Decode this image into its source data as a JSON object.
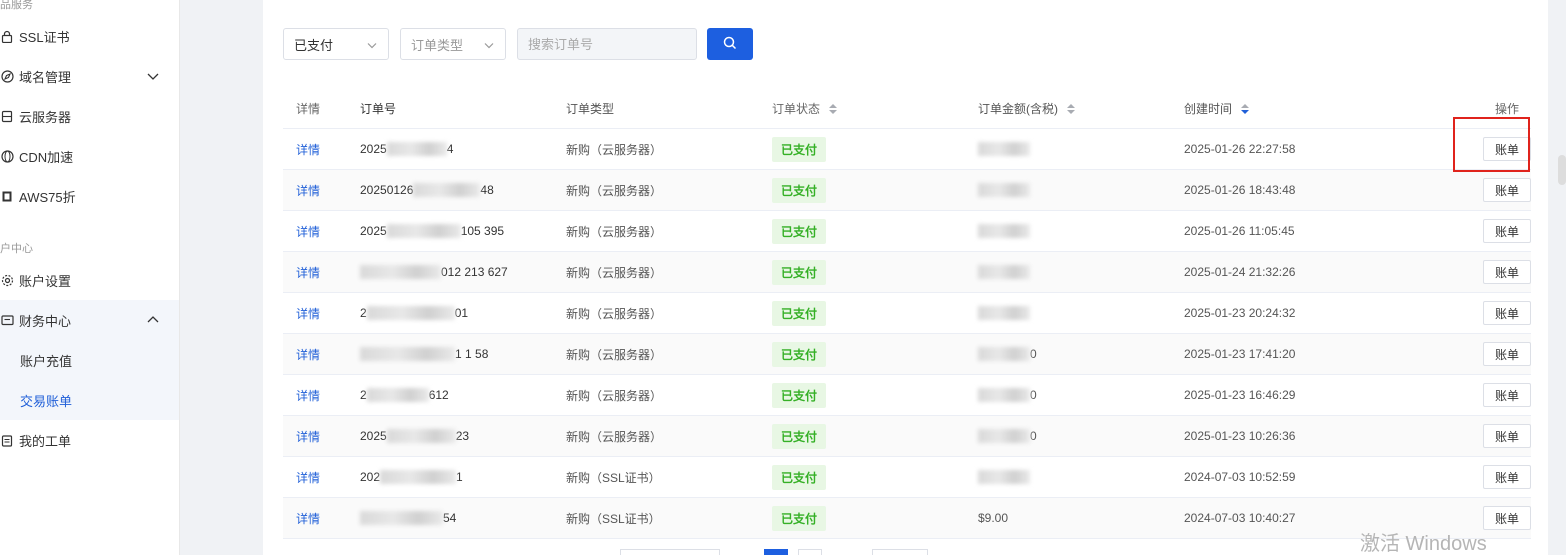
{
  "sidebar": {
    "top_group_label": "品服务",
    "items": [
      {
        "label": "SSL证书",
        "icon": "lock-icon"
      },
      {
        "label": "域名管理",
        "icon": "compass-icon"
      },
      {
        "label": "云服务器",
        "icon": "server-icon"
      },
      {
        "label": "CDN加速",
        "icon": "globe-icon"
      },
      {
        "label": "AWS75折",
        "icon": "aws-icon"
      }
    ],
    "account_group_label": "户中心",
    "account_items": [
      {
        "label": "账户设置",
        "icon": "gear-icon"
      },
      {
        "label": "财务中心",
        "icon": "wallet-icon"
      }
    ],
    "finance_sub": [
      {
        "label": "账户充值"
      },
      {
        "label": "交易账单"
      }
    ],
    "ticket_item": {
      "label": "我的工单",
      "icon": "ticket-icon"
    }
  },
  "filters": {
    "status_value": "已支付",
    "type_placeholder": "订单类型",
    "search_placeholder": "搜索订单号"
  },
  "table": {
    "headers": {
      "detail": "详情",
      "order_no": "订单号",
      "type": "订单类型",
      "status": "订单状态",
      "amount": "订单金额(含税)",
      "created": "创建时间",
      "action": "操作"
    },
    "rows": [
      {
        "detail": "详情",
        "order_no_start": "2025",
        "order_no_end": "4",
        "type": "新购（云服务器）",
        "status": "已支付",
        "amount": "",
        "created": "2025-01-26 22:27:58",
        "action": "账单"
      },
      {
        "detail": "详情",
        "order_no_start": "20250126",
        "order_no_end": "48",
        "type": "新购（云服务器）",
        "status": "已支付",
        "amount": "",
        "created": "2025-01-26 18:43:48",
        "action": "账单"
      },
      {
        "detail": "详情",
        "order_no_start": "2025",
        "order_no_end": "105  395",
        "type": "新购（云服务器）",
        "status": "已支付",
        "amount": "",
        "created": "2025-01-26 11:05:45",
        "action": "账单"
      },
      {
        "detail": "详情",
        "order_no_start": "",
        "order_no_end": "012  213  627",
        "type": "新购（云服务器）",
        "status": "已支付",
        "amount": "",
        "created": "2025-01-24 21:32:26",
        "action": "账单"
      },
      {
        "detail": "详情",
        "order_no_start": "2",
        "order_no_end": "01",
        "type": "新购（云服务器）",
        "status": "已支付",
        "amount": "",
        "created": "2025-01-23 20:24:32",
        "action": "账单"
      },
      {
        "detail": "详情",
        "order_no_start": "",
        "order_no_end": "1  1  58",
        "type": "新购（云服务器）",
        "status": "已支付",
        "amount": "0",
        "created": "2025-01-23 17:41:20",
        "action": "账单"
      },
      {
        "detail": "详情",
        "order_no_start": "2",
        "order_no_end": "612",
        "type": "新购（云服务器）",
        "status": "已支付",
        "amount": "0",
        "created": "2025-01-23 16:46:29",
        "action": "账单"
      },
      {
        "detail": "详情",
        "order_no_start": "2025",
        "order_no_end": "23",
        "type": "新购（云服务器）",
        "status": "已支付",
        "amount": "0",
        "created": "2025-01-23 10:26:36",
        "action": "账单"
      },
      {
        "detail": "详情",
        "order_no_start": "202",
        "order_no_end": "1",
        "type": "新购（SSL证书）",
        "status": "已支付",
        "amount": "",
        "created": "2024-07-03 10:52:59",
        "action": "账单"
      },
      {
        "detail": "详情",
        "order_no_start": "",
        "order_no_end": "54",
        "type": "新购（SSL证书）",
        "status": "已支付",
        "amount": "$9.00",
        "created": "2024-07-03 10:40:27",
        "action": "账单"
      }
    ]
  },
  "watermark": "激活 Windows",
  "colors": {
    "accent": "#1d5fe0",
    "link": "#2160d8",
    "status_green": "#35b026",
    "status_bg": "#e8f7e4",
    "highlight_red": "#e0231c"
  }
}
